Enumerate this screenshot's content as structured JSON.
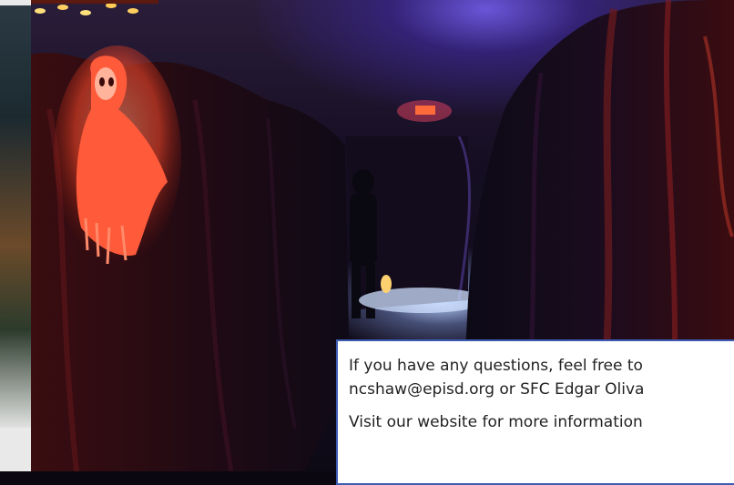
{
  "scene": {
    "photo_icon": "haunted-hallway-photo",
    "accent_colors": {
      "red_light": "#ff3b1f",
      "ghost_glow": "#ff6a4a",
      "blue_light": "#6a55d8",
      "floor_light": "#bcd4ff",
      "box_border": "#3d5bb0"
    }
  },
  "info_box": {
    "line1": "If you have any questions, feel free to",
    "line2": "ncshaw@episd.org or SFC Edgar Oliva",
    "line3": "Visit our website for more information"
  }
}
